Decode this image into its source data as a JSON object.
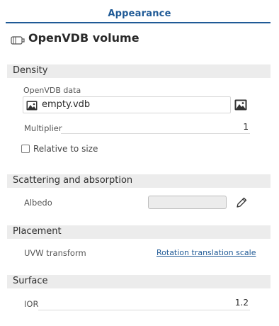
{
  "header": {
    "tab_title": "Appearance",
    "page_title": "OpenVDB volume"
  },
  "sections": {
    "density": {
      "title": "Density",
      "openvdb_data_label": "OpenVDB data",
      "file_name": "empty.vdb",
      "multiplier_label": "Multiplier",
      "multiplier_value": "1",
      "relative_to_size_label": "Relative to size",
      "relative_to_size_checked": false
    },
    "scattering": {
      "title": "Scattering and absorption",
      "albedo_label": "Albedo"
    },
    "placement": {
      "title": "Placement",
      "uvw_label": "UVW transform",
      "uvw_link": "Rotation translation scale"
    },
    "surface": {
      "title": "Surface",
      "ior_label": "IOR",
      "ior_value": "1.2"
    }
  },
  "colors": {
    "accent": "#1f5a96",
    "section_bg": "#ececec",
    "albedo_swatch": "#ececec"
  },
  "icons": [
    "openvdb-volume-icon",
    "image-icon",
    "browse-image-icon",
    "pencil-icon"
  ]
}
